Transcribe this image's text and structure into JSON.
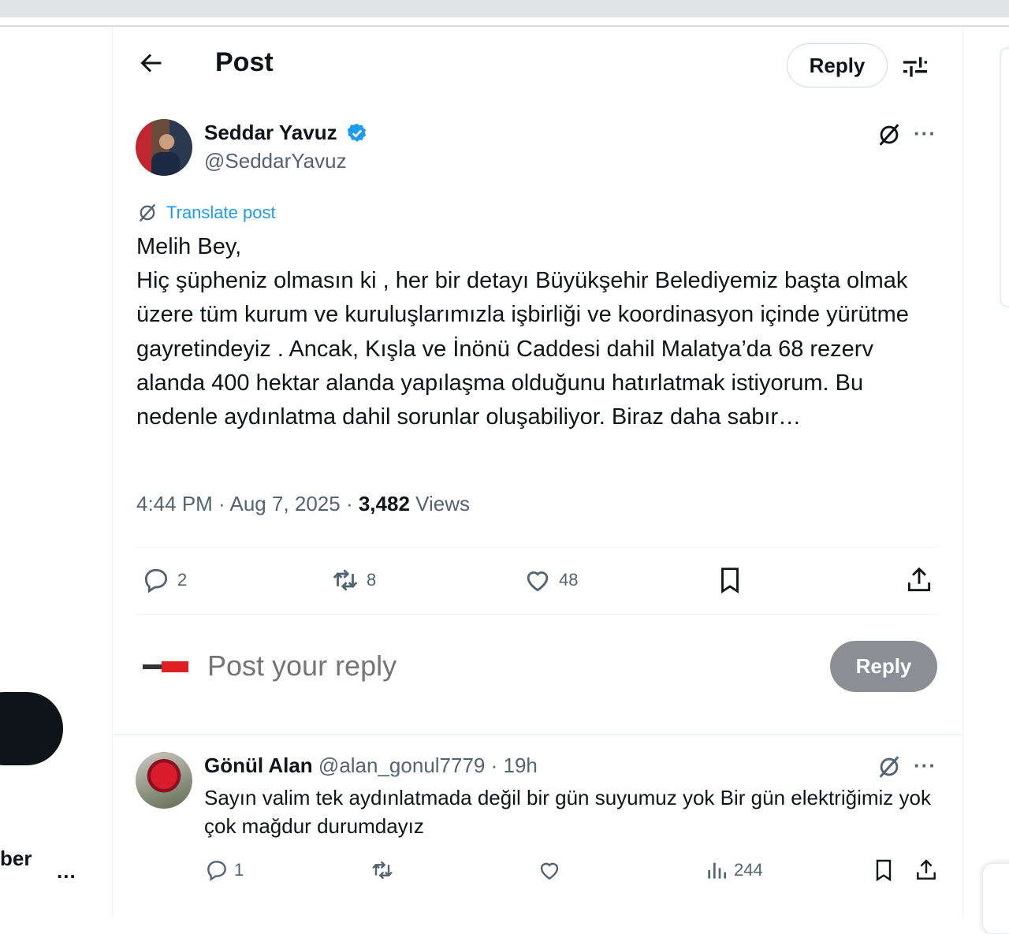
{
  "sidebar": {
    "name_fragment": "ber",
    "more_label": "..."
  },
  "header": {
    "title": "Post",
    "reply_label": "Reply"
  },
  "post": {
    "author_name": "Seddar Yavuz",
    "handle": "@SeddarYavuz",
    "translate_label": "Translate post",
    "text": "Melih Bey,\nHiç şüpheniz olmasın ki , her bir detayı Büyükşehir Belediyemiz başta olmak üzere tüm kurum ve kuruluşlarımızla işbirliği ve koordinasyon içinde yürütme gayretindeyiz . Ancak, Kışla ve İnönü Caddesi dahil Malatya’da 68 rezerv alanda 400 hektar alanda yapılaşma olduğunu hatırlatmak istiyorum. Bu nedenle aydınlatma dahil sorunlar oluşabiliyor. Biraz daha sabır…",
    "time": "4:44 PM · Aug 7, 2025 · ",
    "views_count": "3,482",
    "views_label": " Views",
    "replies": "2",
    "reposts": "8",
    "likes": "48",
    "more_label": "···"
  },
  "composer": {
    "placeholder": "Post your reply",
    "reply_button": "Reply"
  },
  "reply": {
    "author_name": "Gönül Alan",
    "handle_time": " @alan_gonul7779 · 19h",
    "text": "Sayın valim tek aydınlatmada değil bir gün suyumuz yok Bir gün elektriğimiz yok çok mağdur durumdayız",
    "replies": "1",
    "views": "244",
    "more_label": "···"
  },
  "colors": {
    "accent": "#1d9bf0",
    "muted": "#536471",
    "reply_button_bg": "#8b8f93"
  }
}
